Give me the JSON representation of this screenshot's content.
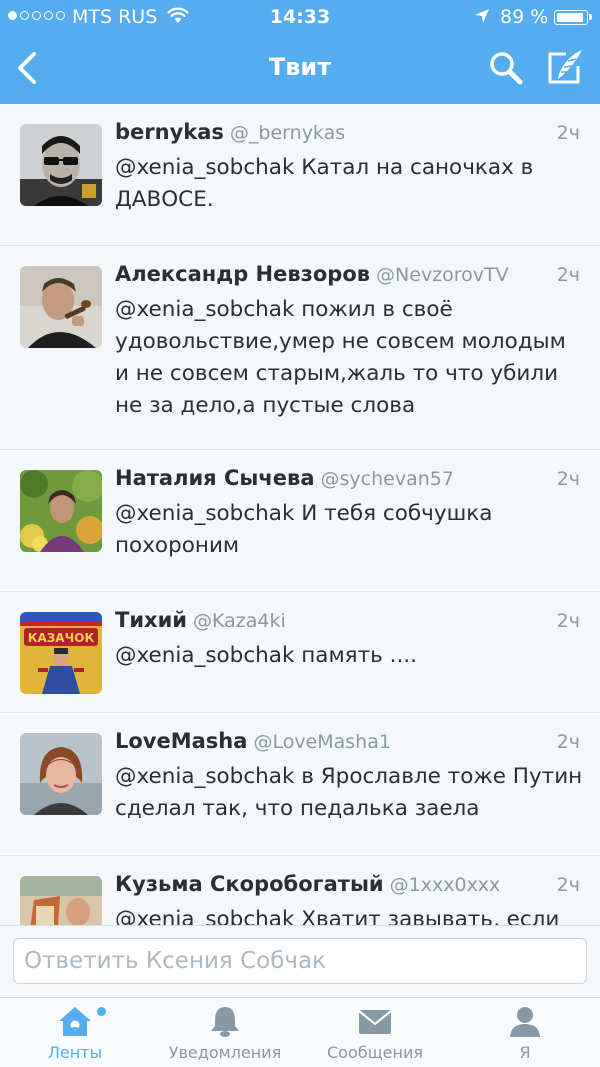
{
  "status_bar": {
    "carrier": "MTS RUS",
    "time": "14:33",
    "battery": "89 %",
    "signal_bars": 1
  },
  "nav": {
    "title": "Твит",
    "back_icon": "chevron-left-icon",
    "search_icon": "search-icon",
    "compose_icon": "compose-icon"
  },
  "tweets": [
    {
      "name": "bernykas",
      "handle": "@_bernykas",
      "time": "2ч",
      "text": "@xenia_sobchak Катал на саночках в ДАВОСЕ."
    },
    {
      "name": "Александр Невзоров",
      "handle": "@NevzorovTV",
      "time": "2ч",
      "text": "@xenia_sobchak пожил в своё удовольствие,умер не совсем молодым и не совсем старым,жаль то что убили не за дело,а пустые слова"
    },
    {
      "name": "Наталия Сычева",
      "handle": "@sychevan57",
      "time": "2ч",
      "text": "@xenia_sobchak И тебя собчушка похороним"
    },
    {
      "name": "Тихий",
      "handle": "@Kaza4ki",
      "time": "2ч",
      "text": "@xenia_sobchak память ...."
    },
    {
      "name": "LoveMasha",
      "handle": "@LoveMasha1",
      "time": "2ч",
      "text": "@xenia_sobchak в Ярославле тоже Путин сделал так, что педалька заела"
    },
    {
      "name": "Кузьма Скоробогатый",
      "handle": "@1xxx0xxx",
      "time": "2ч",
      "text": "@xenia_sobchak Хватит завывать, если"
    }
  ],
  "avatar_text": {
    "kazachok": "КАЗАЧОК"
  },
  "reply": {
    "placeholder": "Ответить Ксения Собчак"
  },
  "tabs": [
    {
      "label": "Ленты",
      "icon": "home-icon",
      "active": true
    },
    {
      "label": "Уведомления",
      "icon": "bell-icon",
      "active": false
    },
    {
      "label": "Сообщения",
      "icon": "envelope-icon",
      "active": false
    },
    {
      "label": "Я",
      "icon": "person-icon",
      "active": false
    }
  ],
  "colors": {
    "brand": "#55acee",
    "text": "#292f33",
    "muted": "#8899a6",
    "background": "#f5f8fa"
  }
}
